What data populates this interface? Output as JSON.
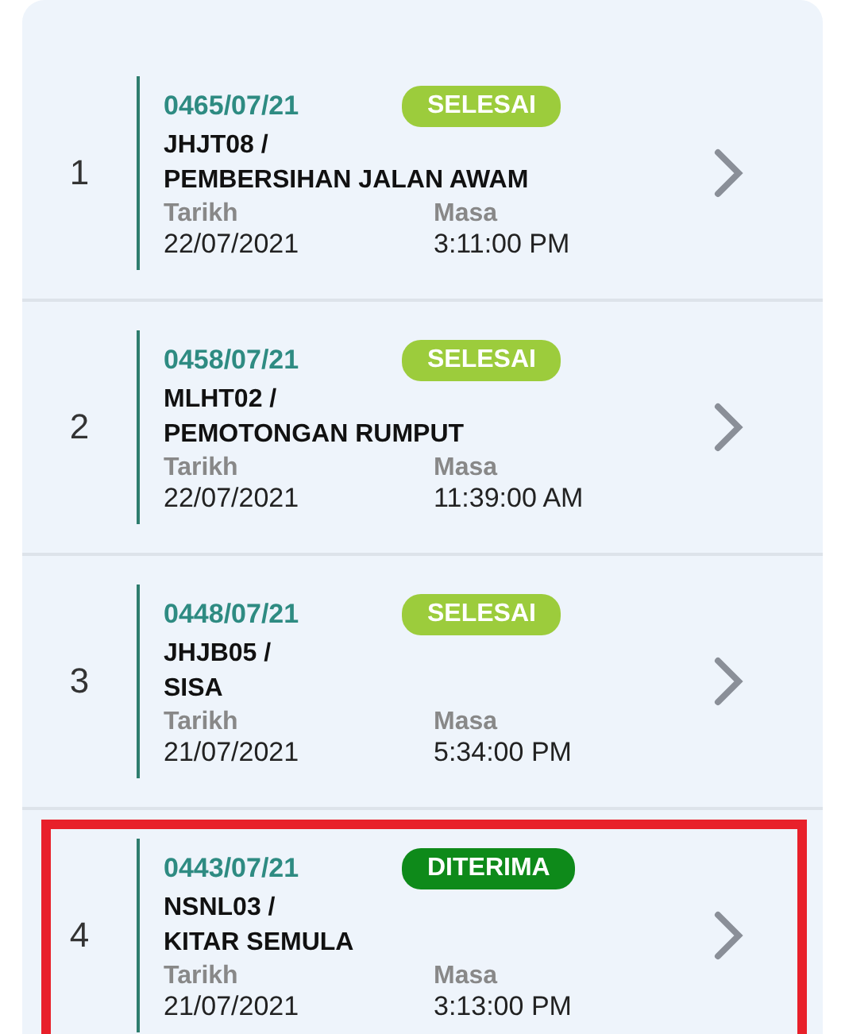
{
  "orders": [
    {
      "number": "1",
      "code": "0465/07/21",
      "status": {
        "label": "SELESAI",
        "color": "#9ccc3c"
      },
      "title_line1": "JHJT08 /",
      "title_line2": "PEMBERSIHAN JALAN AWAM",
      "date_label": "Tarikh",
      "date": "22/07/2021",
      "time_label": "Masa",
      "time": "3:11:00 PM",
      "highlighted": false
    },
    {
      "number": "2",
      "code": "0458/07/21",
      "status": {
        "label": "SELESAI",
        "color": "#9ccc3c"
      },
      "title_line1": "MLHT02 /",
      "title_line2": "PEMOTONGAN RUMPUT",
      "date_label": "Tarikh",
      "date": "22/07/2021",
      "time_label": "Masa",
      "time": "11:39:00 AM",
      "highlighted": false
    },
    {
      "number": "3",
      "code": "0448/07/21",
      "status": {
        "label": "SELESAI",
        "color": "#9ccc3c"
      },
      "title_line1": "JHJB05 /",
      "title_line2": "SISA",
      "date_label": "Tarikh",
      "date": "21/07/2021",
      "time_label": "Masa",
      "time": "5:34:00 PM",
      "highlighted": false
    },
    {
      "number": "4",
      "code": "0443/07/21",
      "status": {
        "label": "DITERIMA",
        "color": "#0e8a1a"
      },
      "title_line1": "NSNL03 /",
      "title_line2": "KITAR SEMULA",
      "date_label": "Tarikh",
      "date": "21/07/2021",
      "time_label": "Masa",
      "time": "3:13:00 PM",
      "highlighted": true
    }
  ]
}
